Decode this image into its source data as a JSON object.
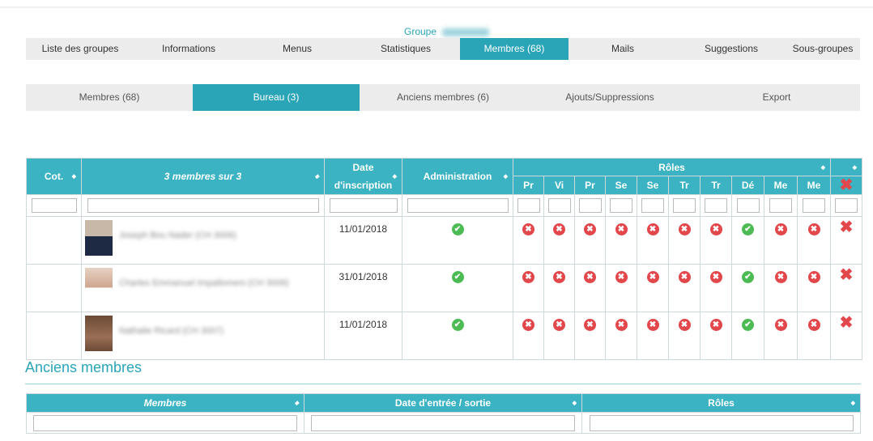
{
  "group": {
    "label": "Groupe",
    "name": "AnalPonds"
  },
  "main_tabs": [
    "Liste des groupes",
    "Informations",
    "Menus",
    "Statistiques",
    "Membres (68)",
    "Mails",
    "Suggestions",
    "Sous-groupes"
  ],
  "active_main_tab": "Membres (68)",
  "sub_tabs": [
    "Membres (68)",
    "Bureau (3)",
    "Anciens membres (6)",
    "Ajouts/Suppressions",
    "Export"
  ],
  "active_sub_tab": "Bureau (3)",
  "table": {
    "headers": {
      "cot": "Cot.",
      "members": "3 membres sur 3",
      "date_line1": "Date",
      "date_line2": "d'inscription",
      "admin": "Administration",
      "roles": "Rôles"
    },
    "roles": [
      "Pr",
      "Vi",
      "Pr",
      "Se",
      "Se",
      "Tr",
      "Tr",
      "Dé",
      "Me",
      "Me"
    ],
    "rows": [
      {
        "name": "Joseph Bou Nader (CH 3006)",
        "date": "11/01/2018",
        "admin": "ok",
        "roles": [
          "no",
          "no",
          "no",
          "no",
          "no",
          "no",
          "no",
          "ok",
          "no",
          "no"
        ]
      },
      {
        "name": "Charles Emmanuel Impallomeni (CH 3008)",
        "date": "31/01/2018",
        "admin": "ok",
        "roles": [
          "no",
          "no",
          "no",
          "no",
          "no",
          "no",
          "no",
          "ok",
          "no",
          "no"
        ]
      },
      {
        "name": "Nathalie Ricard (CH 3007)",
        "date": "11/01/2018",
        "admin": "ok",
        "roles": [
          "no",
          "no",
          "no",
          "no",
          "no",
          "no",
          "no",
          "ok",
          "no",
          "no"
        ]
      }
    ]
  },
  "anciens": {
    "title": "Anciens membres",
    "headers": {
      "members": "Membres",
      "dates": "Date d'entrée / sortie",
      "roles": "Rôles"
    }
  },
  "icons": {
    "ok": "check-circle-icon",
    "no": "cross-circle-icon",
    "remove": "x-icon",
    "sort": "sort-arrows-icon"
  },
  "colors": {
    "accent": "#2aa5b8",
    "header": "#3bb3c3",
    "ok": "#4dbb54",
    "no": "#e2474b"
  }
}
